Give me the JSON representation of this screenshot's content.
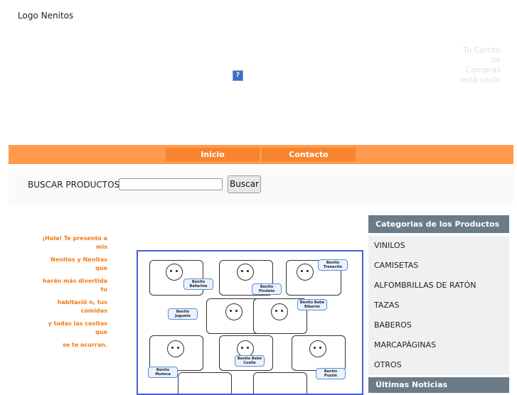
{
  "header": {
    "logo_text": "Logo Nenitos",
    "cart_text": "Tu Carrito de Compras está vacío"
  },
  "nav": {
    "items": [
      "Inicio",
      "Contacto"
    ]
  },
  "search": {
    "label": "BUSCAR PRODUCTOS:",
    "value": "",
    "button": "Buscar"
  },
  "intro": {
    "lines": [
      "¡Hola! Te presento a mis",
      "Nenitos y Nenitas que",
      "harán más divertida tu",
      "habitació n, tus comidas",
      "y todas las cositas que",
      "se te ocurran."
    ]
  },
  "poster": {
    "tags": [
      "Benito Trenecito",
      "Benito Bailarina",
      "Benito Pirulete",
      "Benito Bebé Biberón",
      "Benito Juguete",
      "Benito Bebé Cuello",
      "Benito Muñeca",
      "Benito Puzzle"
    ]
  },
  "sidebar": {
    "categories_title": "Categorias de los Productos",
    "categories": [
      "VINILOS",
      "CAMISETAS",
      "ALFOMBRILLAS DE RATÓN",
      "TAZAS",
      "BABEROS",
      "MARCAPÁGINAS",
      "OTROS"
    ],
    "news_title": "Últimas Noticias"
  },
  "colors": {
    "accent": "#ff9a4e",
    "nav_button": "#f7852f",
    "sidebar_header": "#6b7b87",
    "intro_text": "#f27a14"
  }
}
